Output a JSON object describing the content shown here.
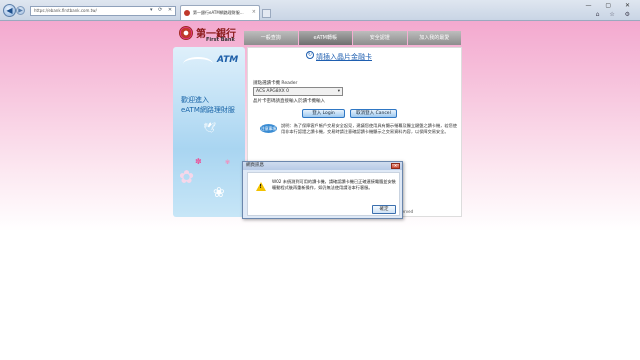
{
  "browser": {
    "address": "https://ebank.firstbank.com.tw/",
    "tab_title": "第一銀行eATM網路理財服...",
    "tab_close": "×",
    "back": "◀",
    "forward": "▶",
    "addr_icons": "▾ ⟳ ✕",
    "window_buttons": "— ▢ ✕",
    "toolbar_icons": "⌂ ☆ ⚙"
  },
  "site": {
    "logo_zh": "第一銀行",
    "logo_en": "First Bank",
    "nav": [
      "一般查詢",
      "eATM轉帳",
      "安全認證",
      "加入我的最愛"
    ],
    "atm_badge": "ATM",
    "welcome_line1": "歡迎進入",
    "welcome_line2": "eATM網路理財服",
    "bird": "🕊",
    "flowers": [
      "✿",
      "❀",
      "✽",
      "✾"
    ]
  },
  "main": {
    "title": "請插入晶片金融卡",
    "title_icon": "↻",
    "reader_label": "請點選讀卡機 Reader",
    "reader_value": "ACS APG8XX 0",
    "reader_arrow": "▾",
    "reader_note": "晶片卡密碼請直接輸入於讀卡機輸入",
    "login_button": "登入 Login",
    "cancel_button": "取消登入 Cancel",
    "note_label": "注意事項",
    "note_text": "說明：為了保障客戶帳戶交易安全起見，建議您使用具有顯示螢幕及獨立鍵盤之讀卡機，若您使用非本行認證之讀卡機，交易時請注意確認讀卡機顯示之交易資料內容，以保障交易安全。",
    "copyright": "© First Bank. All rights reserved"
  },
  "dialog": {
    "title": "網頁訊息",
    "close": "✕",
    "message": "W02 未偵測到可用的讀卡機，請確認讀卡機已正確連接電腦並安裝驅動程式後再重新操作，如仍無法使用請洽本行客服。",
    "ok_button": "確定"
  }
}
